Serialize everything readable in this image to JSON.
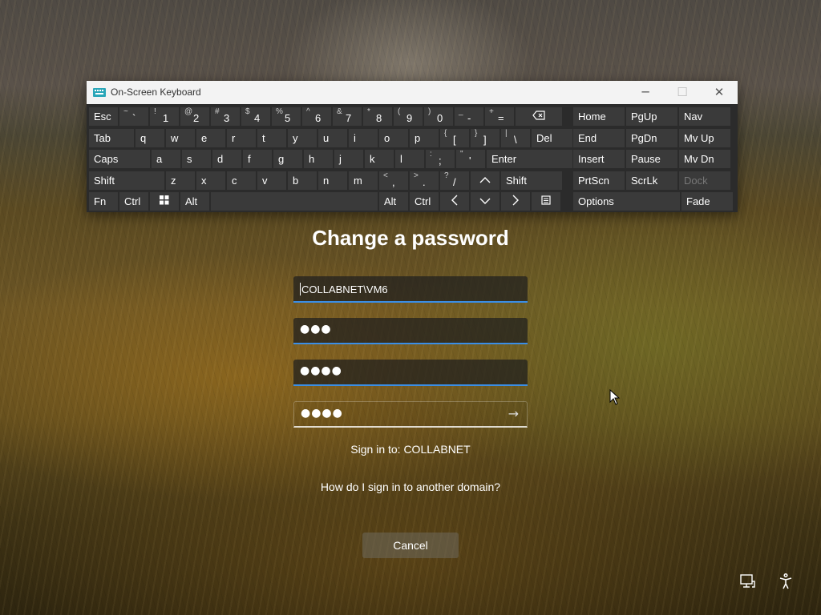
{
  "osk": {
    "title": "On-Screen Keyboard",
    "minimize": "─",
    "maximize": "☐",
    "close": "✕",
    "rows": [
      [
        {
          "main": "Esc"
        },
        {
          "shift": "~",
          "main": "`"
        },
        {
          "shift": "!",
          "main": "1"
        },
        {
          "shift": "@",
          "main": "2"
        },
        {
          "shift": "#",
          "main": "3"
        },
        {
          "shift": "$",
          "main": "4"
        },
        {
          "shift": "%",
          "main": "5"
        },
        {
          "shift": "^",
          "main": "6"
        },
        {
          "shift": "&",
          "main": "7"
        },
        {
          "shift": "*",
          "main": "8"
        },
        {
          "shift": "(",
          "main": "9"
        },
        {
          "shift": ")",
          "main": "0"
        },
        {
          "shift": "_",
          "main": "-"
        },
        {
          "shift": "+",
          "main": "="
        },
        {
          "icon": "backspace"
        },
        {
          "main": "Home"
        },
        {
          "main": "PgUp"
        },
        {
          "main": "Nav"
        }
      ],
      [
        {
          "main": "Tab"
        },
        {
          "main": "q"
        },
        {
          "main": "w"
        },
        {
          "main": "e"
        },
        {
          "main": "r"
        },
        {
          "main": "t"
        },
        {
          "main": "y"
        },
        {
          "main": "u"
        },
        {
          "main": "i"
        },
        {
          "main": "o"
        },
        {
          "main": "p"
        },
        {
          "shift": "{",
          "main": "["
        },
        {
          "shift": "}",
          "main": "]"
        },
        {
          "shift": "|",
          "main": "\\"
        },
        {
          "main": "Del"
        },
        {
          "main": "End"
        },
        {
          "main": "PgDn"
        },
        {
          "main": "Mv Up"
        }
      ],
      [
        {
          "main": "Caps"
        },
        {
          "main": "a"
        },
        {
          "main": "s"
        },
        {
          "main": "d"
        },
        {
          "main": "f"
        },
        {
          "main": "g"
        },
        {
          "main": "h"
        },
        {
          "main": "j"
        },
        {
          "main": "k"
        },
        {
          "main": "l"
        },
        {
          "shift": ":",
          "main": ";"
        },
        {
          "shift": "\"",
          "main": "'"
        },
        {
          "main": "Enter"
        },
        {
          "main": "Insert"
        },
        {
          "main": "Pause"
        },
        {
          "main": "Mv Dn"
        }
      ],
      [
        {
          "main": "Shift"
        },
        {
          "main": "z"
        },
        {
          "main": "x"
        },
        {
          "main": "c"
        },
        {
          "main": "v"
        },
        {
          "main": "b"
        },
        {
          "main": "n"
        },
        {
          "main": "m"
        },
        {
          "shift": "<",
          "main": ","
        },
        {
          "shift": ">",
          "main": "."
        },
        {
          "shift": "?",
          "main": "/"
        },
        {
          "icon": "up"
        },
        {
          "main": "Shift"
        },
        {
          "main": "PrtScn"
        },
        {
          "main": "ScrLk"
        },
        {
          "main": "Dock",
          "dim": true
        }
      ],
      [
        {
          "main": "Fn"
        },
        {
          "main": "Ctrl"
        },
        {
          "icon": "windows"
        },
        {
          "main": "Alt"
        },
        {
          "main": ""
        },
        {
          "main": "Alt"
        },
        {
          "main": "Ctrl"
        },
        {
          "icon": "left"
        },
        {
          "icon": "down"
        },
        {
          "icon": "right"
        },
        {
          "icon": "menu"
        },
        {
          "main": "Options"
        },
        {
          "main": "Fade"
        }
      ]
    ]
  },
  "form": {
    "title": "Change a password",
    "username": "COLLABNET\\VM6",
    "old_password": "●●●",
    "new_password": "●●●●",
    "confirm_password": "●●●●",
    "submit_arrow": "→",
    "sign_in_to": "Sign in to: COLLABNET",
    "other_domain": "How do I sign in to another domain?",
    "cancel": "Cancel"
  },
  "corner": {
    "network_icon": "network-icon",
    "accessibility_icon": "accessibility-icon"
  }
}
